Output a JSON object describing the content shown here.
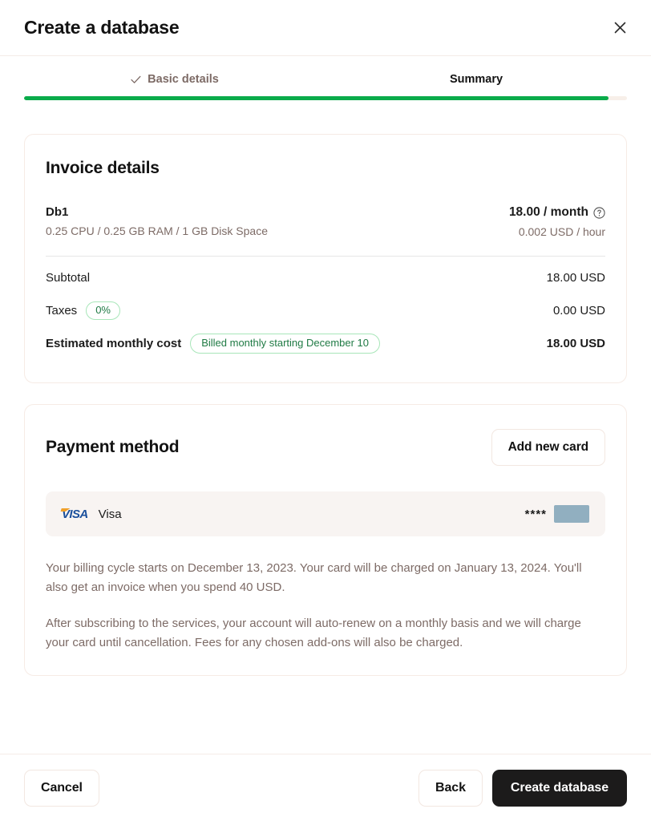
{
  "header": {
    "title": "Create a database",
    "close_icon": "close-icon"
  },
  "stepper": {
    "steps": [
      {
        "label": "Basic details",
        "state": "completed",
        "icon": "check-icon"
      },
      {
        "label": "Summary",
        "state": "current"
      }
    ],
    "progress_percent": 97,
    "fill_color": "#0aab4a",
    "track_color": "#f7efe9"
  },
  "invoice": {
    "title": "Invoice details",
    "item": {
      "name": "Db1",
      "spec": "0.25 CPU / 0.25 GB RAM / 1 GB Disk Space",
      "price": "18.00 / month",
      "rate": "0.002 USD / hour",
      "help_icon": "question-mark-circle-icon"
    },
    "totals": [
      {
        "label": "Subtotal",
        "badge": null,
        "value": "18.00 USD",
        "bold": false
      },
      {
        "label": "Taxes",
        "badge": "0%",
        "value": "0.00 USD",
        "bold": false
      },
      {
        "label": "Estimated monthly cost",
        "badge": "Billed monthly starting December 10",
        "value": "18.00 USD",
        "bold": true
      }
    ]
  },
  "payment": {
    "title": "Payment method",
    "add_card_label": "Add new card",
    "card": {
      "logo_text": "VISA",
      "brand": "Visa",
      "mask": "****",
      "redacted": true,
      "redacted_color": "#91afc0"
    },
    "notes": [
      "Your billing cycle starts on December 13, 2023. Your card will be charged on January 13, 2024. You'll also get an invoice when you spend 40 USD.",
      "After subscribing to the services, your account will auto-renew on a monthly basis and we will charge your card until cancellation. Fees for any chosen add-ons will also be charged."
    ]
  },
  "footer": {
    "cancel_label": "Cancel",
    "back_label": "Back",
    "create_label": "Create database",
    "primary_color": "#1c1b1b"
  },
  "colors": {
    "accent_green": "#0aab4a",
    "pill_green_text": "#1f7a44",
    "pill_green_border": "#a8e6b9",
    "muted_text": "#7d6b66",
    "panel_border": "#f6ebe5",
    "card_row_bg": "#f8f4f2"
  }
}
